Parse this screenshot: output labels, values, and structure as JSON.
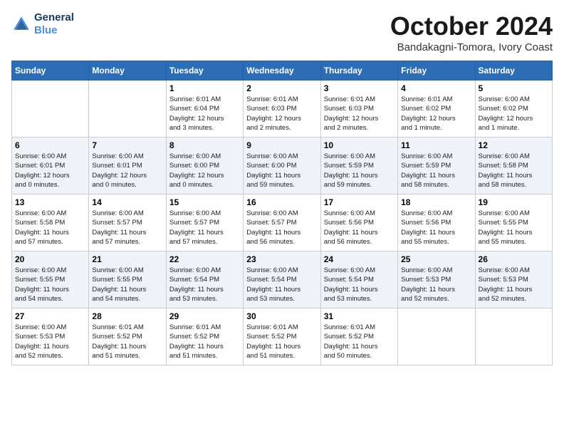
{
  "header": {
    "logo_line1": "General",
    "logo_line2": "Blue",
    "month": "October 2024",
    "location": "Bandakagni-Tomora, Ivory Coast"
  },
  "weekdays": [
    "Sunday",
    "Monday",
    "Tuesday",
    "Wednesday",
    "Thursday",
    "Friday",
    "Saturday"
  ],
  "weeks": [
    [
      {
        "day": "",
        "info": ""
      },
      {
        "day": "",
        "info": ""
      },
      {
        "day": "1",
        "info": "Sunrise: 6:01 AM\nSunset: 6:04 PM\nDaylight: 12 hours\nand 3 minutes."
      },
      {
        "day": "2",
        "info": "Sunrise: 6:01 AM\nSunset: 6:03 PM\nDaylight: 12 hours\nand 2 minutes."
      },
      {
        "day": "3",
        "info": "Sunrise: 6:01 AM\nSunset: 6:03 PM\nDaylight: 12 hours\nand 2 minutes."
      },
      {
        "day": "4",
        "info": "Sunrise: 6:01 AM\nSunset: 6:02 PM\nDaylight: 12 hours\nand 1 minute."
      },
      {
        "day": "5",
        "info": "Sunrise: 6:00 AM\nSunset: 6:02 PM\nDaylight: 12 hours\nand 1 minute."
      }
    ],
    [
      {
        "day": "6",
        "info": "Sunrise: 6:00 AM\nSunset: 6:01 PM\nDaylight: 12 hours\nand 0 minutes."
      },
      {
        "day": "7",
        "info": "Sunrise: 6:00 AM\nSunset: 6:01 PM\nDaylight: 12 hours\nand 0 minutes."
      },
      {
        "day": "8",
        "info": "Sunrise: 6:00 AM\nSunset: 6:00 PM\nDaylight: 12 hours\nand 0 minutes."
      },
      {
        "day": "9",
        "info": "Sunrise: 6:00 AM\nSunset: 6:00 PM\nDaylight: 11 hours\nand 59 minutes."
      },
      {
        "day": "10",
        "info": "Sunrise: 6:00 AM\nSunset: 5:59 PM\nDaylight: 11 hours\nand 59 minutes."
      },
      {
        "day": "11",
        "info": "Sunrise: 6:00 AM\nSunset: 5:59 PM\nDaylight: 11 hours\nand 58 minutes."
      },
      {
        "day": "12",
        "info": "Sunrise: 6:00 AM\nSunset: 5:58 PM\nDaylight: 11 hours\nand 58 minutes."
      }
    ],
    [
      {
        "day": "13",
        "info": "Sunrise: 6:00 AM\nSunset: 5:58 PM\nDaylight: 11 hours\nand 57 minutes."
      },
      {
        "day": "14",
        "info": "Sunrise: 6:00 AM\nSunset: 5:57 PM\nDaylight: 11 hours\nand 57 minutes."
      },
      {
        "day": "15",
        "info": "Sunrise: 6:00 AM\nSunset: 5:57 PM\nDaylight: 11 hours\nand 57 minutes."
      },
      {
        "day": "16",
        "info": "Sunrise: 6:00 AM\nSunset: 5:57 PM\nDaylight: 11 hours\nand 56 minutes."
      },
      {
        "day": "17",
        "info": "Sunrise: 6:00 AM\nSunset: 5:56 PM\nDaylight: 11 hours\nand 56 minutes."
      },
      {
        "day": "18",
        "info": "Sunrise: 6:00 AM\nSunset: 5:56 PM\nDaylight: 11 hours\nand 55 minutes."
      },
      {
        "day": "19",
        "info": "Sunrise: 6:00 AM\nSunset: 5:55 PM\nDaylight: 11 hours\nand 55 minutes."
      }
    ],
    [
      {
        "day": "20",
        "info": "Sunrise: 6:00 AM\nSunset: 5:55 PM\nDaylight: 11 hours\nand 54 minutes."
      },
      {
        "day": "21",
        "info": "Sunrise: 6:00 AM\nSunset: 5:55 PM\nDaylight: 11 hours\nand 54 minutes."
      },
      {
        "day": "22",
        "info": "Sunrise: 6:00 AM\nSunset: 5:54 PM\nDaylight: 11 hours\nand 53 minutes."
      },
      {
        "day": "23",
        "info": "Sunrise: 6:00 AM\nSunset: 5:54 PM\nDaylight: 11 hours\nand 53 minutes."
      },
      {
        "day": "24",
        "info": "Sunrise: 6:00 AM\nSunset: 5:54 PM\nDaylight: 11 hours\nand 53 minutes."
      },
      {
        "day": "25",
        "info": "Sunrise: 6:00 AM\nSunset: 5:53 PM\nDaylight: 11 hours\nand 52 minutes."
      },
      {
        "day": "26",
        "info": "Sunrise: 6:00 AM\nSunset: 5:53 PM\nDaylight: 11 hours\nand 52 minutes."
      }
    ],
    [
      {
        "day": "27",
        "info": "Sunrise: 6:00 AM\nSunset: 5:53 PM\nDaylight: 11 hours\nand 52 minutes."
      },
      {
        "day": "28",
        "info": "Sunrise: 6:01 AM\nSunset: 5:52 PM\nDaylight: 11 hours\nand 51 minutes."
      },
      {
        "day": "29",
        "info": "Sunrise: 6:01 AM\nSunset: 5:52 PM\nDaylight: 11 hours\nand 51 minutes."
      },
      {
        "day": "30",
        "info": "Sunrise: 6:01 AM\nSunset: 5:52 PM\nDaylight: 11 hours\nand 51 minutes."
      },
      {
        "day": "31",
        "info": "Sunrise: 6:01 AM\nSunset: 5:52 PM\nDaylight: 11 hours\nand 50 minutes."
      },
      {
        "day": "",
        "info": ""
      },
      {
        "day": "",
        "info": ""
      }
    ]
  ]
}
